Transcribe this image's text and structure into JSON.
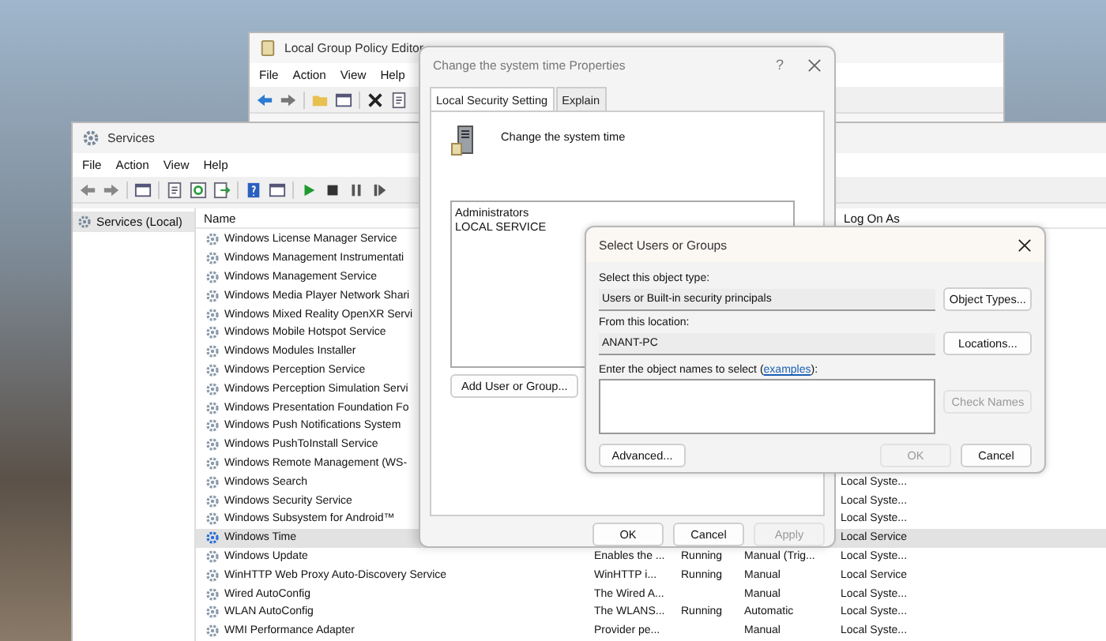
{
  "group_policy_editor": {
    "title": "Local Group Policy Editor",
    "menu": [
      "File",
      "Action",
      "View",
      "Help"
    ]
  },
  "services_window": {
    "title": "Services",
    "menu": [
      "File",
      "Action",
      "View",
      "Help"
    ],
    "tree": [
      {
        "label": "Services (Local)",
        "selected": true
      }
    ],
    "columns": [
      "Name",
      "Log On As"
    ],
    "rows": [
      {
        "name": "Windows License Manager Service",
        "selected": false
      },
      {
        "name": "Windows Management Instrumentati",
        "selected": false
      },
      {
        "name": "Windows Management Service",
        "selected": false
      },
      {
        "name": "Windows Media Player Network Shari",
        "selected": false
      },
      {
        "name": "Windows Mixed Reality OpenXR Servi",
        "selected": false
      },
      {
        "name": "Windows Mobile Hotspot Service",
        "selected": false
      },
      {
        "name": "Windows Modules Installer",
        "selected": false
      },
      {
        "name": "Windows Perception Service",
        "selected": false
      },
      {
        "name": "Windows Perception Simulation Servi",
        "selected": false
      },
      {
        "name": "Windows Presentation Foundation Fo",
        "selected": false
      },
      {
        "name": "Windows Push Notifications System",
        "selected": false
      },
      {
        "name": "Windows PushToInstall Service",
        "selected": false
      },
      {
        "name": "Windows Remote Management (WS-",
        "selected": false
      },
      {
        "name": "Windows Search",
        "selected": false,
        "log_on_as": "Local Syste..."
      },
      {
        "name": "Windows Security Service",
        "selected": false,
        "log_on_as": "Local Syste..."
      },
      {
        "name": "Windows Subsystem for Android™",
        "selected": false,
        "log_on_as": "Local Syste..."
      },
      {
        "name": "Windows Time",
        "selected": true,
        "log_on_as": "Local Service"
      },
      {
        "name": "Windows Update",
        "selected": false,
        "description": "Enables the ...",
        "status": "Running",
        "startup_type": "Manual (Trig...",
        "log_on_as": "Local Syste..."
      },
      {
        "name": "WinHTTP Web Proxy Auto-Discovery Service",
        "selected": false,
        "description": "WinHTTP i...",
        "status": "Running",
        "startup_type": "Manual",
        "log_on_as": "Local Service"
      },
      {
        "name": "Wired AutoConfig",
        "selected": false,
        "description": "The Wired A...",
        "startup_type": "Manual",
        "log_on_as": "Local Syste..."
      },
      {
        "name": "WLAN AutoConfig",
        "selected": false,
        "description": "The WLANS...",
        "status": "Running",
        "startup_type": "Automatic",
        "log_on_as": "Local Syste..."
      },
      {
        "name": "WMI Performance Adapter",
        "selected": false,
        "description": "Provider pe...",
        "startup_type": "Manual",
        "log_on_as": "Local Syste..."
      }
    ]
  },
  "properties_dialog": {
    "title": "Change the system time Properties",
    "help": "?",
    "tabs": [
      {
        "label": "Local Security Setting",
        "selected": true
      },
      {
        "label": "Explain",
        "selected": false
      }
    ],
    "policy_name": "Change the system time",
    "members": [
      "Administrators",
      "LOCAL SERVICE"
    ],
    "add_button": "Add User or Group...",
    "buttons": [
      {
        "label": "OK",
        "disabled": false
      },
      {
        "label": "Cancel",
        "disabled": false
      },
      {
        "label": "Apply",
        "disabled": true
      }
    ]
  },
  "select_users_dialog": {
    "title": "Select Users or Groups",
    "object_type_label": "Select this object type:",
    "object_type": "Users or Built-in security principals",
    "object_types_button": "Object Types...",
    "location_label": "From this location:",
    "location": "ANANT-PC",
    "locations_button": "Locations...",
    "names_prompt_start": "Enter the object names to select (",
    "examples_link": "examples",
    "names_prompt_end": "):",
    "check_names_button": {
      "label": "Check Names",
      "disabled": true
    },
    "advanced_button": "Advanced...",
    "ok_button": {
      "label": "OK",
      "disabled": true
    },
    "cancel_button": {
      "label": "Cancel",
      "disabled": false
    }
  }
}
